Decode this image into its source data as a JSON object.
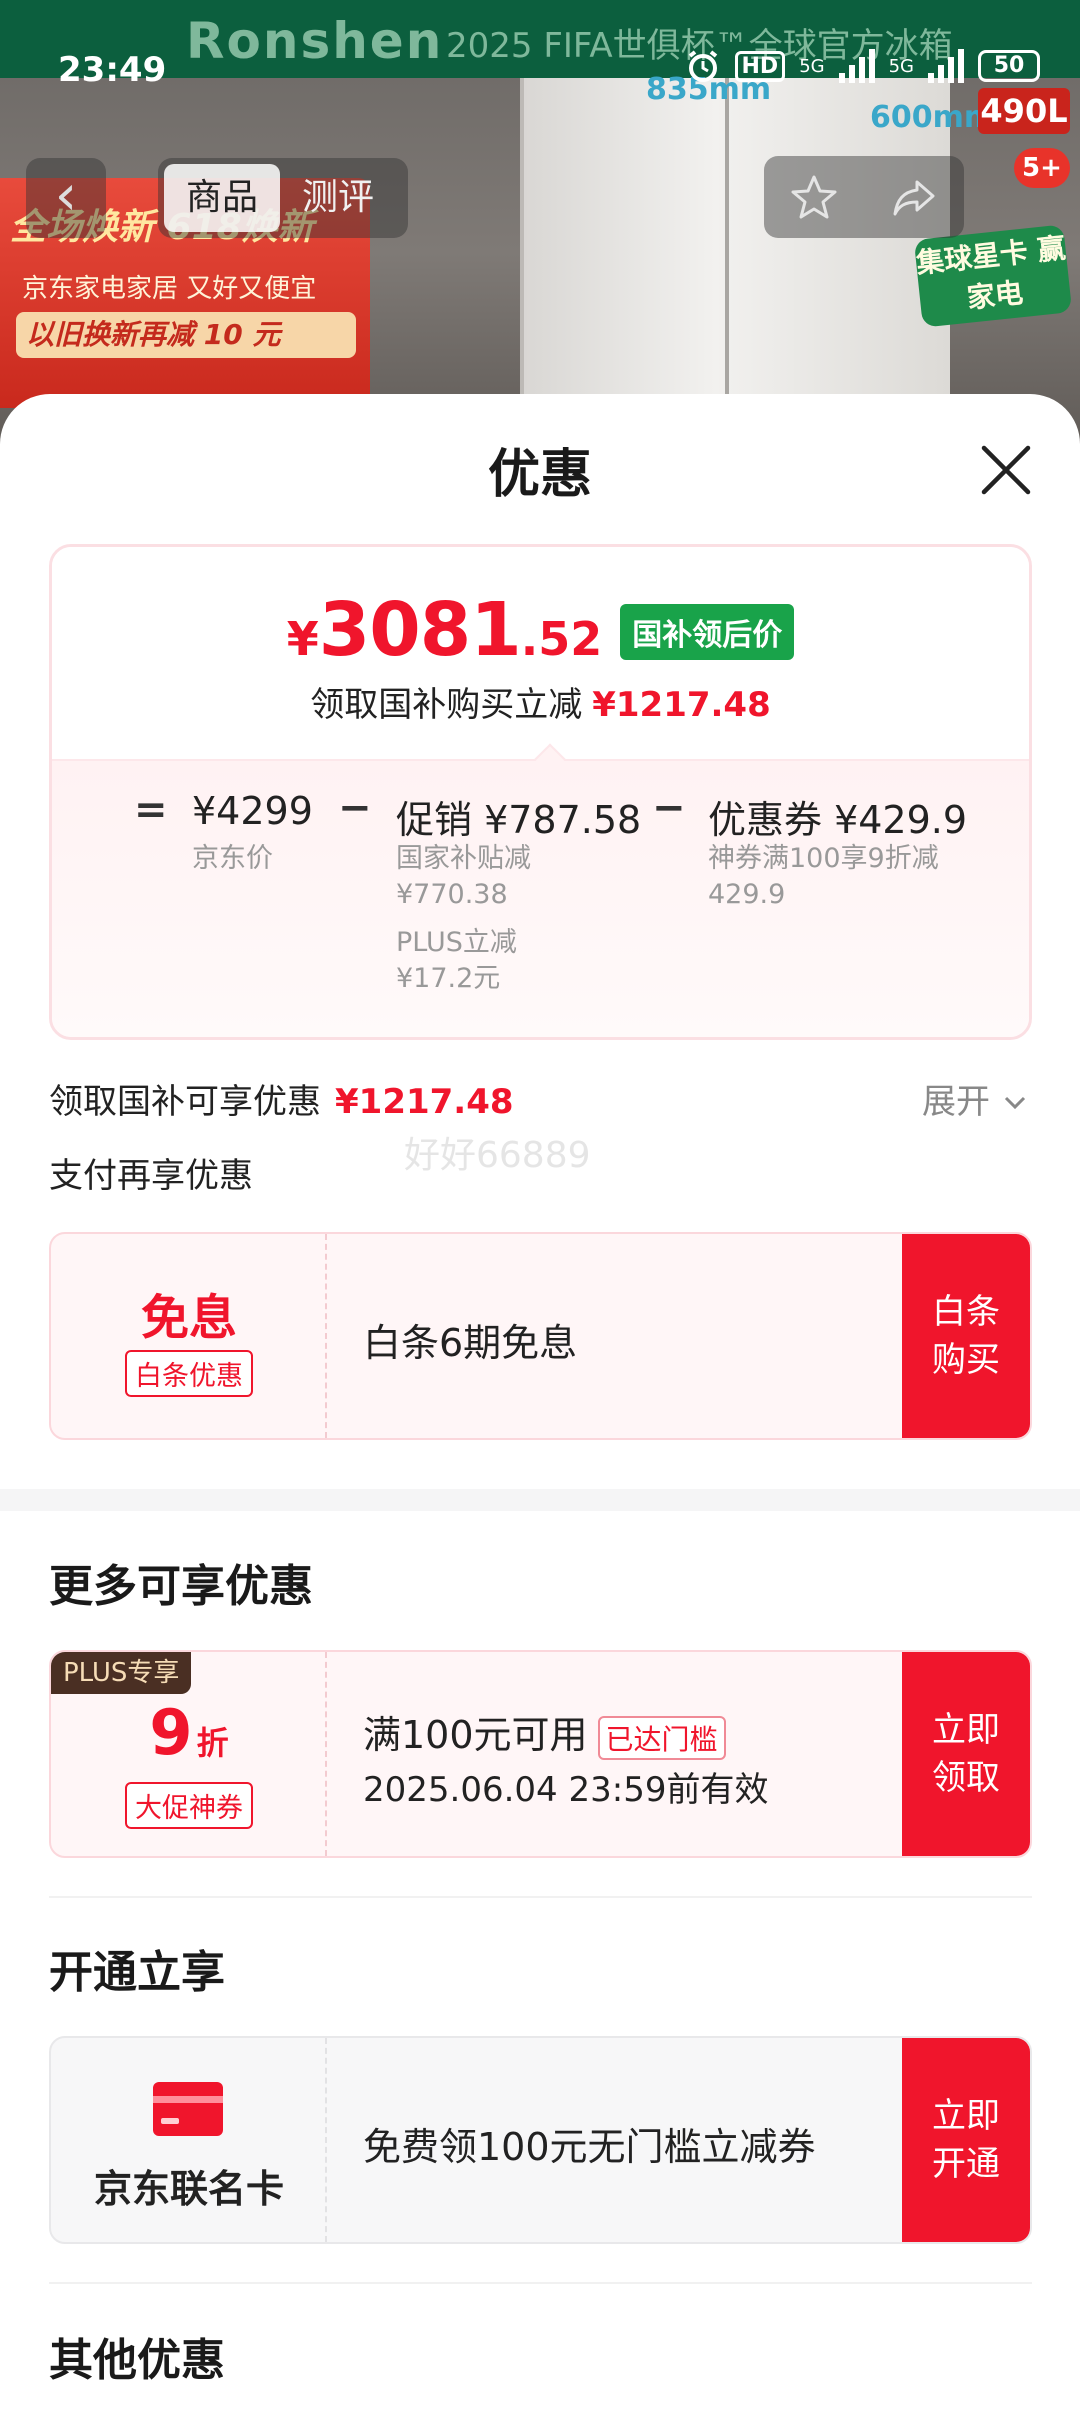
{
  "status_bar": {
    "time": "23:49",
    "hd": "HD",
    "net1": "5G",
    "net2": "5G",
    "battery": "50"
  },
  "background": {
    "brand": "Ronshen",
    "brand_sub": "2025 FIFA世俱杯™全球官方冰箱",
    "dim_width": "835mm",
    "dim_depth": "600mm",
    "capacity": "490L",
    "promo_line1": "全场焕新 618焕新",
    "promo_line2": "京东家电家居 又好又便宜",
    "promo_line3": "以旧换新再减 10 元",
    "badge_count": "5+",
    "green_badge": "集球星卡 赢家电"
  },
  "nav": {
    "tabs": [
      "商品",
      "测评"
    ],
    "active_tab": 0
  },
  "sheet": {
    "title": "优惠",
    "price_card": {
      "yen": "¥",
      "price_int": "3081",
      "price_dec": ".52",
      "price_tag": "国补领后价",
      "sub_label": "领取国补购买立减",
      "sub_amount": "¥1217.48",
      "eq": "=",
      "minus": "−",
      "jd_price": "¥4299",
      "jd_price_label": "京东价",
      "promo_label": "促销 ¥787.58",
      "promo_detail1": "国家补贴减",
      "promo_detail1_amount": "¥770.38",
      "promo_detail2": "PLUS立减",
      "promo_detail2_amount": "¥17.2元",
      "coupon_label": "优惠券 ¥429.9",
      "coupon_detail": "神券满100享9折减",
      "coupon_detail_amount": "429.9"
    },
    "national_subsidy_label": "领取国补可享优惠",
    "national_subsidy_amount": "¥1217.48",
    "expand_label": "展开",
    "pay_more_label": "支付再享优惠",
    "watermark": "好好66889",
    "baitiao": {
      "title": "免息",
      "tag": "白条优惠",
      "text": "白条6期免息",
      "button": "白条购买"
    },
    "more_section_title": "更多可享优惠",
    "plus_coupon": {
      "plus_badge": "PLUS专享",
      "discount_num": "9",
      "discount_unit": "折",
      "tag": "大促神券",
      "condition": "满100元可用",
      "reached_tag": "已达门槛",
      "expiry": "2025.06.04 23:59前有效",
      "button": "立即领取"
    },
    "open_section_title": "开通立享",
    "jd_card": {
      "name": "京东联名卡",
      "text": "免费领100元无门槛立减券",
      "button": "立即开通"
    },
    "other_section_title": "其他优惠"
  },
  "colors": {
    "accent_red": "#f0152c",
    "subsidy_green": "#19a34a",
    "brand_green": "#0c5f3e"
  }
}
